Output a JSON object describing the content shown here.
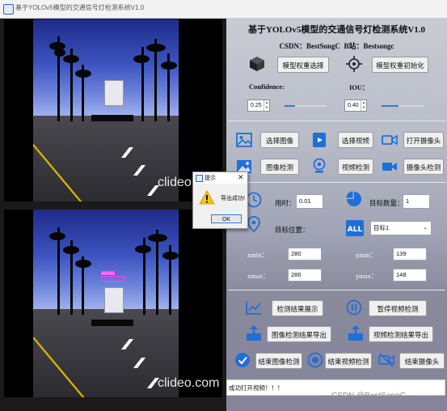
{
  "window": {
    "title": "基于YOLOv5模型的交通信号灯检测系统V1.0"
  },
  "video_watermark": "clideo.com",
  "video2_detection_label": "red 0.54",
  "header": {
    "title": "基于YOLOv5模型的交通信号灯检测系统V1.0",
    "csdn": "CSDN：BestSongC",
    "bilibili": "B站：Bestsongc"
  },
  "model": {
    "select_button": "模型权重选择",
    "init_button": "模型权重初始化",
    "icons": {
      "select": "cube-icon",
      "init": "crosshair-icon"
    }
  },
  "params": {
    "confidence_label": "Confidence:",
    "confidence_value": "0.25",
    "confidence_fraction": 0.25,
    "iou_label": "IOU：",
    "iou_value": "0.40",
    "iou_fraction": 0.4
  },
  "media": {
    "select_image": "选择图像",
    "select_video": "选择视频",
    "open_camera": "打开摄像头",
    "image_detect": "图像检测",
    "video_detect": "视频检测",
    "camera_detect": "摄像头检测"
  },
  "results": {
    "time_label": "用时：",
    "time_value": "0.01",
    "count_label": "目标数量：",
    "count_value": "1",
    "position_label": "目标位置：",
    "target_select": "目标1",
    "xmin_label": "xmin：",
    "xmin_value": "280",
    "ymin_label": "ymin：",
    "ymin_value": "139",
    "xmax_label": "xmax：",
    "xmax_value": "286",
    "ymax_label": "ymax：",
    "ymax_value": "148"
  },
  "actions": {
    "show_results": "检测结果展示",
    "pause_video": "暂停视频检测",
    "export_image": "图像检测结果导出",
    "export_video": "视频检测结果导出",
    "end_image": "结束图像检测",
    "end_video": "结束视频检测",
    "end_camera": "结束摄像头"
  },
  "status": {
    "message": "成功打开视频！！！"
  },
  "csdn_watermark": "CSDN @BestSongC",
  "dialog": {
    "title": "提示",
    "message": "导出成功!",
    "ok": "OK",
    "close": "✕"
  },
  "colors": {
    "accent": "#2b7de0",
    "icon_blue": "#1f6fd8"
  }
}
